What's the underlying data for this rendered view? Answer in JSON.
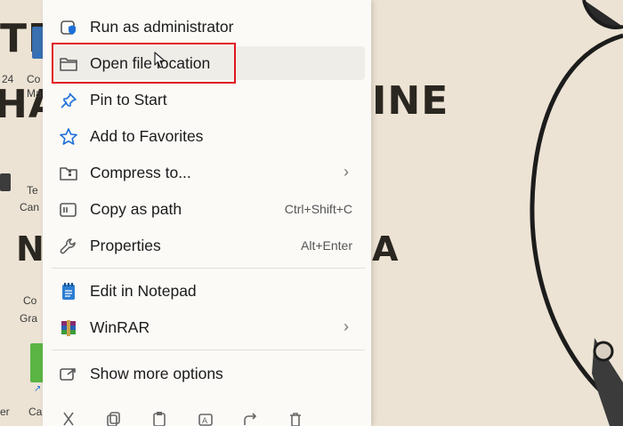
{
  "wallpaper": {
    "text_tr": "TR",
    "text_ha": "HA",
    "text_ine": "INE",
    "text_n": "N",
    "text_a": "A",
    "desktop_labels": [
      "24",
      "Co",
      "Ma",
      "Te",
      "Can",
      "Co",
      "Gra",
      "er",
      "Ca"
    ]
  },
  "context_menu": {
    "items": [
      {
        "label": "Run as administrator",
        "icon": "shield-app-icon",
        "shortcut": "",
        "submenu": false
      },
      {
        "label": "Open file location",
        "icon": "folder-icon",
        "shortcut": "",
        "submenu": false
      },
      {
        "label": "Pin to Start",
        "icon": "pin-icon",
        "shortcut": "",
        "submenu": false
      },
      {
        "label": "Add to Favorites",
        "icon": "star-icon",
        "shortcut": "",
        "submenu": false
      },
      {
        "label": "Compress to...",
        "icon": "zip-folder-icon",
        "shortcut": "",
        "submenu": true
      },
      {
        "label": "Copy as path",
        "icon": "copy-path-icon",
        "shortcut": "Ctrl+Shift+C",
        "submenu": false
      },
      {
        "label": "Properties",
        "icon": "wrench-icon",
        "shortcut": "Alt+Enter",
        "submenu": false
      },
      {
        "label": "Edit in Notepad",
        "icon": "notepad-icon",
        "shortcut": "",
        "submenu": false
      },
      {
        "label": "WinRAR",
        "icon": "winrar-icon",
        "shortcut": "",
        "submenu": true
      },
      {
        "label": "Show more options",
        "icon": "share-options-icon",
        "shortcut": "",
        "submenu": false
      }
    ],
    "submenu_glyph": "›",
    "hovered_item": "Open file location"
  },
  "colors": {
    "highlight_box": "#e0171f",
    "menu_bg": "#fbfaf7",
    "accent_blue": "#1e6fd9"
  }
}
